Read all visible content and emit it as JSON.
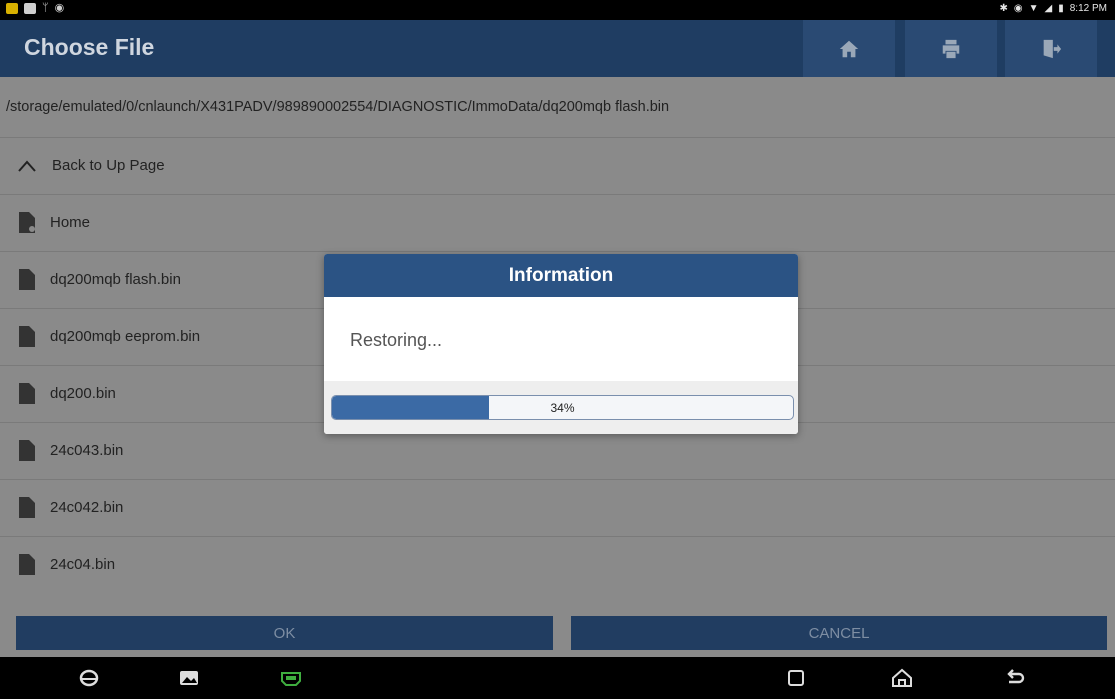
{
  "status_bar": {
    "time": "8:12 PM"
  },
  "header": {
    "title": "Choose File",
    "buttons": [
      "home-icon",
      "print-icon",
      "exit-icon"
    ]
  },
  "path": "/storage/emulated/0/cnlaunch/X431PADV/989890002554/DIAGNOSTIC/ImmoData/dq200mqb flash.bin",
  "list": {
    "back_label": "Back to Up Page",
    "items": [
      {
        "label": "Home",
        "icon": "folder-icon"
      },
      {
        "label": "dq200mqb flash.bin",
        "icon": "file-icon"
      },
      {
        "label": "dq200mqb eeprom.bin",
        "icon": "file-icon"
      },
      {
        "label": "dq200.bin",
        "icon": "file-icon"
      },
      {
        "label": "24c043.bin",
        "icon": "file-icon"
      },
      {
        "label": "24c042.bin",
        "icon": "file-icon"
      },
      {
        "label": "24c04.bin",
        "icon": "file-icon"
      }
    ]
  },
  "buttons": {
    "ok": "OK",
    "cancel": "CANCEL"
  },
  "dialog": {
    "title": "Information",
    "message": "Restoring...",
    "progress_text": "34%",
    "progress": 0.34
  },
  "colors": {
    "header": "#1f3d62",
    "dialog_title": "#2b5384",
    "progress_fill": "#3b6aa5"
  }
}
